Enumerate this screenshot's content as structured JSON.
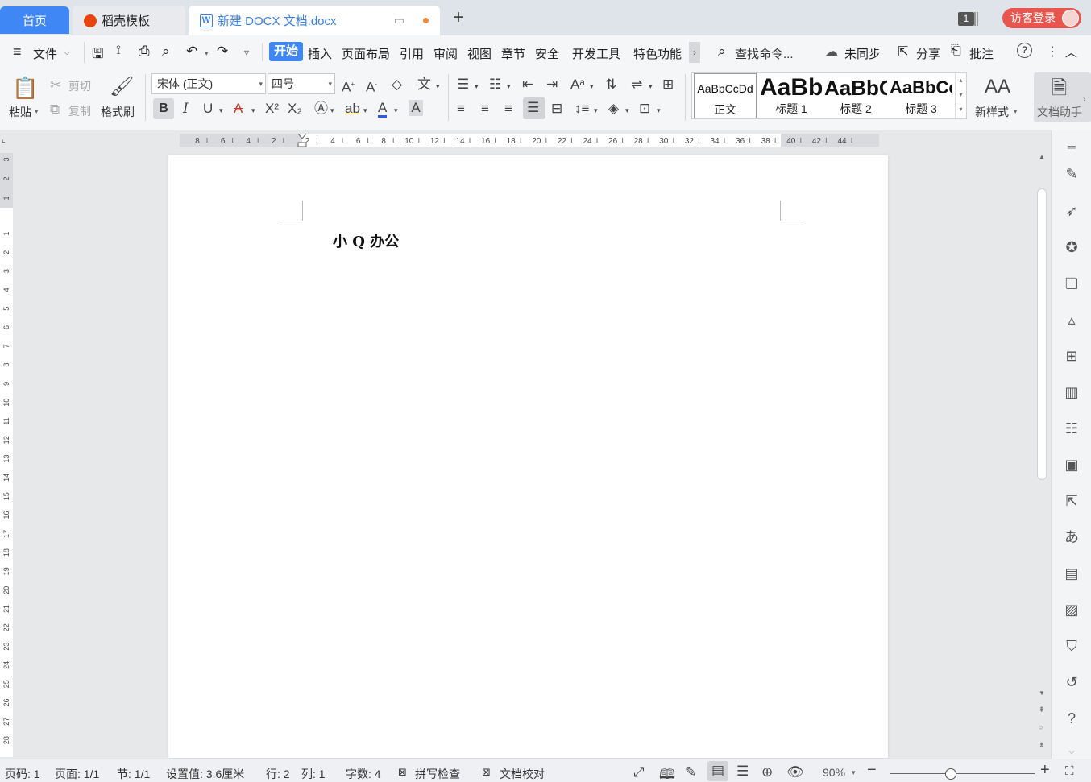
{
  "tabs": {
    "home": "首页",
    "daoke": "稻壳模板",
    "doc": "新建 DOCX 文档.docx",
    "add": "+"
  },
  "window": {
    "badge": "1",
    "login": "访客登录"
  },
  "menu": {
    "file": "文件",
    "items": [
      "开始",
      "插入",
      "页面布局",
      "引用",
      "审阅",
      "视图",
      "章节",
      "安全",
      "开发工具",
      "特色功能"
    ],
    "more": "›",
    "search": "查找命令...",
    "sync": "未同步",
    "share": "分享",
    "comment": "批注",
    "help": "?"
  },
  "ribbon": {
    "paste": "粘贴",
    "cut": "剪切",
    "copy": "复制",
    "format_painter": "格式刷",
    "font_name": "宋体 (正文)",
    "font_size": "四号",
    "bold": "B",
    "italic": "I",
    "underline": "U",
    "strike": "A",
    "sup": "X²",
    "sub": "X₂",
    "font_color": "A",
    "char_shade": "A",
    "styles": [
      {
        "sample": "AaBbCcDd",
        "name": "正文"
      },
      {
        "sample": "AaBb",
        "name": "标题 1"
      },
      {
        "sample": "AaBbC",
        "name": "标题 2"
      },
      {
        "sample": "AaBbCc",
        "name": "标题 3"
      }
    ],
    "new_style": "新样式",
    "doc_helper": "文档助手"
  },
  "ruler": {
    "h_ticks": [
      "8",
      "6",
      "4",
      "2",
      "2",
      "4",
      "6",
      "8",
      "10",
      "12",
      "14",
      "16",
      "18",
      "20",
      "22",
      "24",
      "26",
      "28",
      "30",
      "32",
      "34",
      "36",
      "38",
      "40",
      "42",
      "44"
    ],
    "v_ticks": [
      "3",
      "2",
      "1",
      "1",
      "2",
      "3",
      "4",
      "5",
      "6",
      "7",
      "8",
      "9",
      "10",
      "11",
      "12",
      "13",
      "14",
      "15",
      "16",
      "17",
      "18",
      "19",
      "20",
      "21",
      "22",
      "23",
      "24",
      "25",
      "26",
      "27",
      "28"
    ]
  },
  "document": {
    "text": "小 Q 办公"
  },
  "status": {
    "page_no": "页码: 1",
    "pages": "页面: 1/1",
    "section": "节: 1/1",
    "setting": "设置值: 3.6厘米",
    "row": "行: 2",
    "col": "列: 1",
    "words": "字数: 4",
    "spell": "拼写检查",
    "proof": "文档校对",
    "zoom": "90%"
  }
}
